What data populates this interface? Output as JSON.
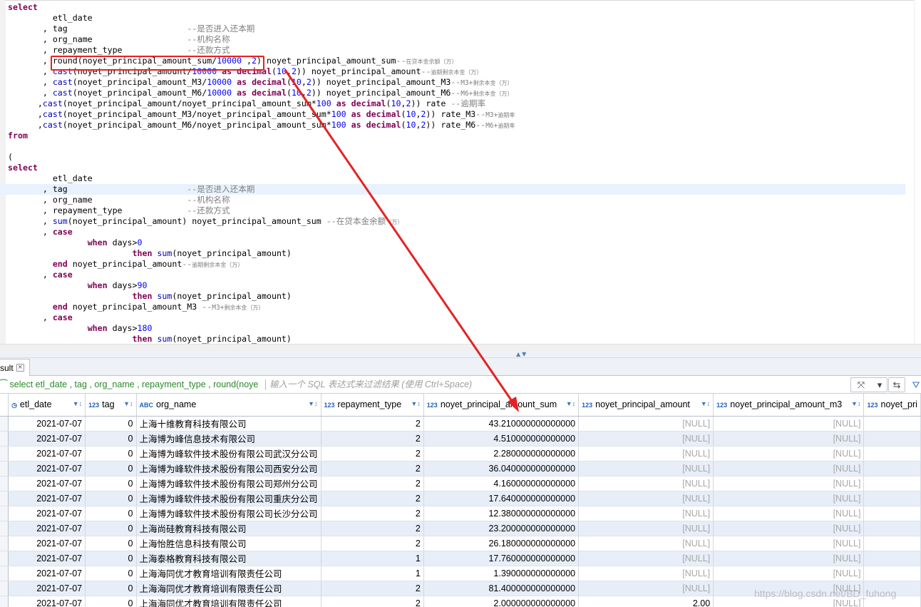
{
  "editor": {
    "lines": [
      {
        "segs": [
          [
            "kw",
            "select"
          ]
        ]
      },
      {
        "segs": [
          [
            "",
            "         etl_date"
          ]
        ]
      },
      {
        "segs": [
          [
            "",
            "       , tag                        "
          ],
          [
            "cm",
            "--是否进入还本期"
          ]
        ]
      },
      {
        "segs": [
          [
            "",
            "       , org_name                   "
          ],
          [
            "cm",
            "--机构名称"
          ]
        ]
      },
      {
        "segs": [
          [
            "",
            "       , repayment_type             "
          ],
          [
            "cm",
            "--还款方式"
          ]
        ]
      },
      {
        "segs": [
          [
            "",
            "       , round(noyet_principal_amount_sum/"
          ],
          [
            "num",
            "10000"
          ],
          [
            "",
            " ,"
          ],
          [
            "num",
            "2"
          ],
          [
            "",
            ") noyet_principal_amount_sum"
          ],
          [
            "cm",
            "--"
          ],
          [
            "cm-s",
            "在贷本金余额（万）"
          ]
        ]
      },
      {
        "segs": [
          [
            "",
            "       , "
          ],
          [
            "fn",
            "cast"
          ],
          [
            "",
            "(noyet_principal_amount/"
          ],
          [
            "num",
            "10000"
          ],
          [
            "",
            " "
          ],
          [
            "kw",
            "as"
          ],
          [
            "",
            " "
          ],
          [
            "kw",
            "decimal"
          ],
          [
            "",
            "("
          ],
          [
            "num",
            "10"
          ],
          [
            "",
            ","
          ],
          [
            "num",
            "2"
          ],
          [
            "",
            ")) noyet_principal_amount"
          ],
          [
            "cm",
            "--"
          ],
          [
            "cm-s",
            "逾期剩余本金（万）"
          ]
        ]
      },
      {
        "segs": [
          [
            "",
            "       , "
          ],
          [
            "fn",
            "cast"
          ],
          [
            "",
            "(noyet_principal_amount_M3/"
          ],
          [
            "num",
            "10000"
          ],
          [
            "",
            " "
          ],
          [
            "kw",
            "as"
          ],
          [
            "",
            " "
          ],
          [
            "kw",
            "decimal"
          ],
          [
            "",
            "("
          ],
          [
            "num",
            "10"
          ],
          [
            "",
            ","
          ],
          [
            "num",
            "2"
          ],
          [
            "",
            ")) noyet_principal_amount_M3"
          ],
          [
            "cm",
            "--"
          ],
          [
            "cm-m",
            "M3+"
          ],
          [
            "cm-s",
            "剩余本金（万）"
          ]
        ]
      },
      {
        "segs": [
          [
            "",
            "       , "
          ],
          [
            "fn",
            "cast"
          ],
          [
            "",
            "(noyet_principal_amount_M6/"
          ],
          [
            "num",
            "10000"
          ],
          [
            "",
            " "
          ],
          [
            "kw",
            "as"
          ],
          [
            "",
            " "
          ],
          [
            "kw",
            "decimal"
          ],
          [
            "",
            "("
          ],
          [
            "num",
            "10"
          ],
          [
            "",
            ","
          ],
          [
            "num",
            "2"
          ],
          [
            "",
            ")) noyet_principal_amount_M6"
          ],
          [
            "cm",
            "--"
          ],
          [
            "cm-m",
            "M6+"
          ],
          [
            "cm-s",
            "剩余本金（万）"
          ]
        ]
      },
      {
        "segs": [
          [
            "",
            "      ,"
          ],
          [
            "fn",
            "cast"
          ],
          [
            "",
            "(noyet_principal_amount/noyet_principal_amount_sum*"
          ],
          [
            "num",
            "100"
          ],
          [
            "",
            " "
          ],
          [
            "kw",
            "as"
          ],
          [
            "",
            " "
          ],
          [
            "kw",
            "decimal"
          ],
          [
            "",
            "("
          ],
          [
            "num",
            "10"
          ],
          [
            "",
            ","
          ],
          [
            "num",
            "2"
          ],
          [
            "",
            ")) rate "
          ],
          [
            "cm",
            "--逾期率"
          ]
        ]
      },
      {
        "segs": [
          [
            "",
            "      ,"
          ],
          [
            "fn",
            "cast"
          ],
          [
            "",
            "(noyet_principal_amount_M3/noyet_principal_amount_sum*"
          ],
          [
            "num",
            "100"
          ],
          [
            "",
            " "
          ],
          [
            "kw",
            "as"
          ],
          [
            "",
            " "
          ],
          [
            "kw",
            "decimal"
          ],
          [
            "",
            "("
          ],
          [
            "num",
            "10"
          ],
          [
            "",
            ","
          ],
          [
            "num",
            "2"
          ],
          [
            "",
            ")) rate_M3"
          ],
          [
            "cm",
            "--"
          ],
          [
            "cm-m",
            "M3+"
          ],
          [
            "cm-s",
            "逾期率"
          ]
        ]
      },
      {
        "segs": [
          [
            "",
            "      ,"
          ],
          [
            "fn",
            "cast"
          ],
          [
            "",
            "(noyet_principal_amount_M6/noyet_principal_amount_sum*"
          ],
          [
            "num",
            "100"
          ],
          [
            "",
            " "
          ],
          [
            "kw",
            "as"
          ],
          [
            "",
            " "
          ],
          [
            "kw",
            "decimal"
          ],
          [
            "",
            "("
          ],
          [
            "num",
            "10"
          ],
          [
            "",
            ","
          ],
          [
            "num",
            "2"
          ],
          [
            "",
            ")) rate_M6"
          ],
          [
            "cm",
            "--"
          ],
          [
            "cm-m",
            "M6+"
          ],
          [
            "cm-s",
            "逾期率"
          ]
        ]
      },
      {
        "segs": [
          [
            "kw",
            "from"
          ]
        ]
      },
      {
        "segs": [
          [
            "",
            ""
          ]
        ]
      },
      {
        "segs": [
          [
            "",
            "("
          ]
        ]
      },
      {
        "segs": [
          [
            "kw",
            "select"
          ]
        ]
      },
      {
        "segs": [
          [
            "",
            "         etl_date"
          ]
        ]
      },
      {
        "hl": true,
        "segs": [
          [
            "",
            "       , tag                        "
          ],
          [
            "cm",
            "--是否进入还本期"
          ]
        ]
      },
      {
        "segs": [
          [
            "",
            "       , org_name                   "
          ],
          [
            "cm",
            "--机构名称"
          ]
        ]
      },
      {
        "segs": [
          [
            "",
            "       , repayment_type             "
          ],
          [
            "cm",
            "--还款方式"
          ]
        ]
      },
      {
        "segs": [
          [
            "",
            "       , "
          ],
          [
            "fn",
            "sum"
          ],
          [
            "",
            "(noyet_principal_amount) noyet_principal_amount_sum "
          ],
          [
            "cm",
            "--在贷本金余额"
          ],
          [
            "cm-s",
            "（万）"
          ]
        ]
      },
      {
        "segs": [
          [
            "",
            "       , "
          ],
          [
            "kw",
            "case"
          ]
        ]
      },
      {
        "segs": [
          [
            "",
            "                "
          ],
          [
            "kw",
            "when"
          ],
          [
            "",
            " days>"
          ],
          [
            "num",
            "0"
          ]
        ]
      },
      {
        "segs": [
          [
            "",
            "                         "
          ],
          [
            "kw",
            "then"
          ],
          [
            "",
            " "
          ],
          [
            "fn",
            "sum"
          ],
          [
            "",
            "(noyet_principal_amount)"
          ]
        ]
      },
      {
        "segs": [
          [
            "",
            "         "
          ],
          [
            "kw",
            "end"
          ],
          [
            "",
            " noyet_principal_amount"
          ],
          [
            "cm",
            "--"
          ],
          [
            "cm-s",
            "逾期剩余本金（万）"
          ]
        ]
      },
      {
        "segs": [
          [
            "",
            "       , "
          ],
          [
            "kw",
            "case"
          ]
        ]
      },
      {
        "segs": [
          [
            "",
            "                "
          ],
          [
            "kw",
            "when"
          ],
          [
            "",
            " days>"
          ],
          [
            "num",
            "90"
          ]
        ]
      },
      {
        "segs": [
          [
            "",
            "                         "
          ],
          [
            "kw",
            "then"
          ],
          [
            "",
            " "
          ],
          [
            "fn",
            "sum"
          ],
          [
            "",
            "(noyet_principal_amount)"
          ]
        ]
      },
      {
        "segs": [
          [
            "",
            "         "
          ],
          [
            "kw",
            "end"
          ],
          [
            "",
            " noyet_principal_amount_M3 "
          ],
          [
            "cm",
            "--"
          ],
          [
            "cm-m",
            "M3+"
          ],
          [
            "cm-s",
            "剩余本金（万）"
          ]
        ]
      },
      {
        "segs": [
          [
            "",
            "       , "
          ],
          [
            "kw",
            "case"
          ]
        ]
      },
      {
        "segs": [
          [
            "",
            "                "
          ],
          [
            "kw",
            "when"
          ],
          [
            "",
            " days>"
          ],
          [
            "num",
            "180"
          ]
        ]
      },
      {
        "segs": [
          [
            "",
            "                         "
          ],
          [
            "kw",
            "then"
          ],
          [
            "",
            " "
          ],
          [
            "fn",
            "sum"
          ],
          [
            "",
            "(noyet_principal_amount)"
          ]
        ]
      }
    ]
  },
  "result_tab": {
    "label": "sult",
    "close": "⊠"
  },
  "filter": {
    "query": "⁀ select etl_date , tag , org_name , repayment_type , round(noye",
    "placeholder": "输入一个 SQL 表达式来过滤结果 (使用 Ctrl+Space)"
  },
  "grid": {
    "columns": [
      {
        "name": "etl_date",
        "type": "◷",
        "width": 113
      },
      {
        "name": "tag",
        "type": "123",
        "width": 75
      },
      {
        "name": "org_name",
        "type": "ABC",
        "width": 252
      },
      {
        "name": "repayment_type",
        "type": "123",
        "width": 148
      },
      {
        "name": "noyet_principal_amount_sum",
        "type": "123",
        "width": 221
      },
      {
        "name": "noyet_principal_amount",
        "type": "123",
        "width": 193
      },
      {
        "name": "noyet_principal_amount_m3",
        "type": "123",
        "width": 215
      },
      {
        "name": "noyet_pri",
        "type": "123",
        "width": 75
      }
    ],
    "rows": [
      [
        "2021-07-07",
        "0",
        "上海十维教育科技有限公司",
        "2",
        "43.210000000000000",
        "[NULL]",
        "[NULL]"
      ],
      [
        "2021-07-07",
        "0",
        "上海博为峰信息技术有限公司",
        "2",
        "4.510000000000000",
        "[NULL]",
        "[NULL]"
      ],
      [
        "2021-07-07",
        "0",
        "上海博为峰软件技术股份有限公司武汉分公司",
        "2",
        "2.280000000000000",
        "[NULL]",
        "[NULL]"
      ],
      [
        "2021-07-07",
        "0",
        "上海博为峰软件技术股份有限公司西安分公司",
        "2",
        "36.040000000000000",
        "[NULL]",
        "[NULL]"
      ],
      [
        "2021-07-07",
        "0",
        "上海博为峰软件技术股份有限公司郑州分公司",
        "2",
        "4.160000000000000",
        "[NULL]",
        "[NULL]"
      ],
      [
        "2021-07-07",
        "0",
        "上海博为峰软件技术股份有限公司重庆分公司",
        "2",
        "17.640000000000000",
        "[NULL]",
        "[NULL]"
      ],
      [
        "2021-07-07",
        "0",
        "上海博为峰软件技术股份有限公司长沙分公司",
        "2",
        "12.380000000000000",
        "[NULL]",
        "[NULL]"
      ],
      [
        "2021-07-07",
        "0",
        "上海尚硅教育科技有限公司",
        "2",
        "23.200000000000000",
        "[NULL]",
        "[NULL]"
      ],
      [
        "2021-07-07",
        "0",
        "上海怡胜信息科技有限公司",
        "2",
        "26.180000000000000",
        "[NULL]",
        "[NULL]"
      ],
      [
        "2021-07-07",
        "0",
        "上海泰格教育科技有限公司",
        "1",
        "17.760000000000000",
        "[NULL]",
        "[NULL]"
      ],
      [
        "2021-07-07",
        "0",
        "上海海同优才教育培训有限责任公司",
        "1",
        "1.390000000000000",
        "[NULL]",
        "[NULL]"
      ],
      [
        "2021-07-07",
        "0",
        "上海海同优才教育培训有限责任公司",
        "2",
        "81.400000000000000",
        "[NULL]",
        "[NULL]"
      ],
      [
        "2021-07-07",
        "0",
        "上海海同优才教育培训有限责任公司",
        "2",
        "2.000000000000000",
        "2.00",
        "[NULL]"
      ]
    ]
  },
  "watermark": "https://blog.csdn.net/BD_fuhong",
  "colors": {
    "annotation": "#e52222",
    "row_alt": "#e7eef8"
  }
}
